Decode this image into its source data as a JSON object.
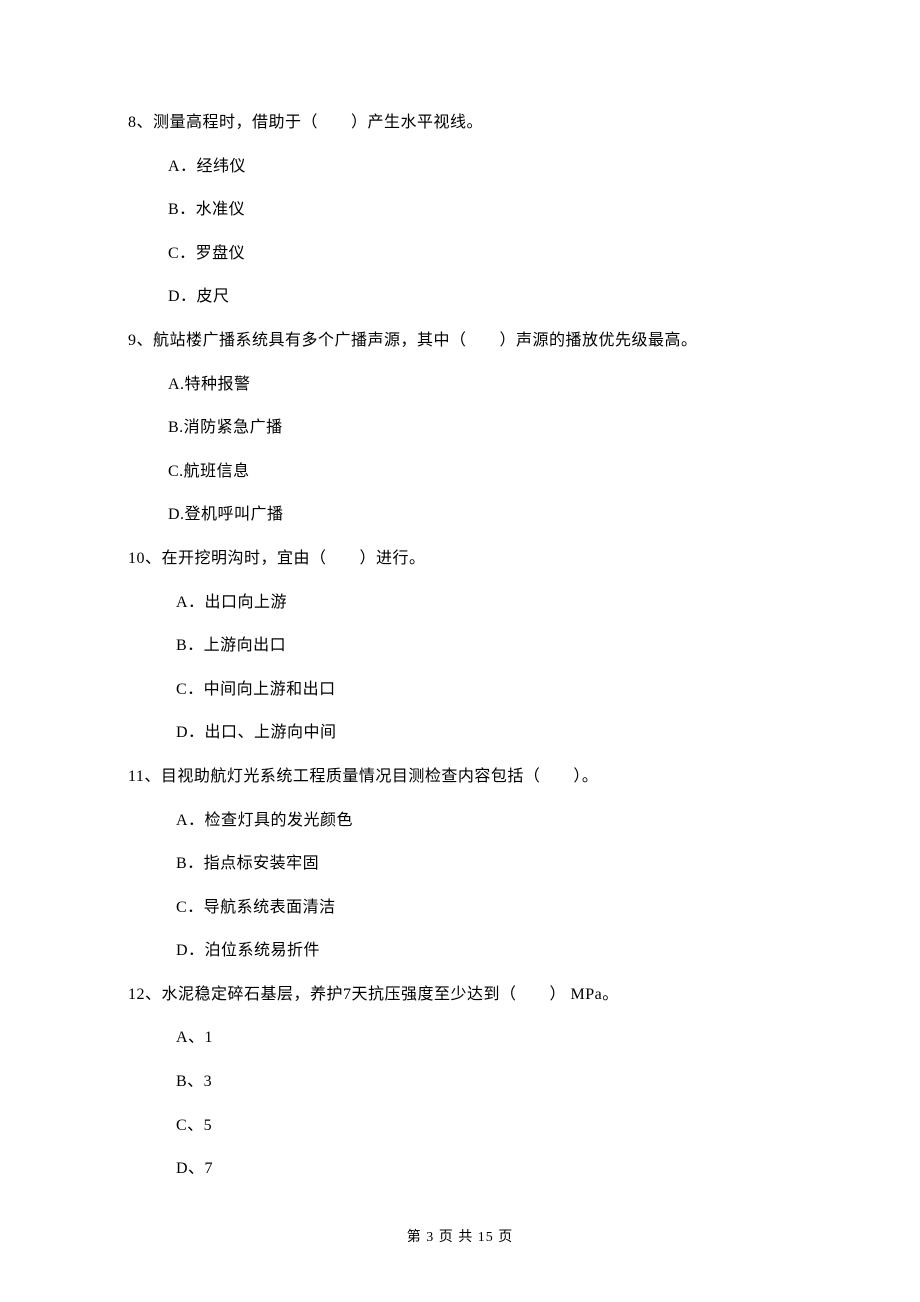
{
  "questions": [
    {
      "num": "8、",
      "text": "测量高程时，借助于（　　）产生水平视线。",
      "options": [
        "A．经纬仪",
        "B．水准仪",
        "C．罗盘仪",
        "D．皮尺"
      ]
    },
    {
      "num": "9、",
      "text": "航站楼广播系统具有多个广播声源，其中（　　）声源的播放优先级最高。",
      "options": [
        "A.特种报警",
        "B.消防紧急广播",
        "C.航班信息",
        "D.登机呼叫广播"
      ]
    },
    {
      "num": "10、",
      "text": "在开挖明沟时，宜由（　　）进行。",
      "options": [
        "A．出口向上游",
        "B．上游向出口",
        "C．中间向上游和出口",
        "D．出口、上游向中间"
      ]
    },
    {
      "num": "11、",
      "text": "目视助航灯光系统工程质量情况目测检查内容包括（　　）。",
      "options": [
        "A．检查灯具的发光颜色",
        "B．指点标安装牢固",
        "C．导航系统表面清洁",
        "D．泊位系统易折件"
      ]
    },
    {
      "num": "12、",
      "text": "水泥稳定碎石基层，养护7天抗压强度至少达到（　　） MPa。",
      "options": [
        "A、1",
        "B、3",
        "C、5",
        "D、7"
      ]
    }
  ],
  "footer": "第 3 页 共 15 页"
}
